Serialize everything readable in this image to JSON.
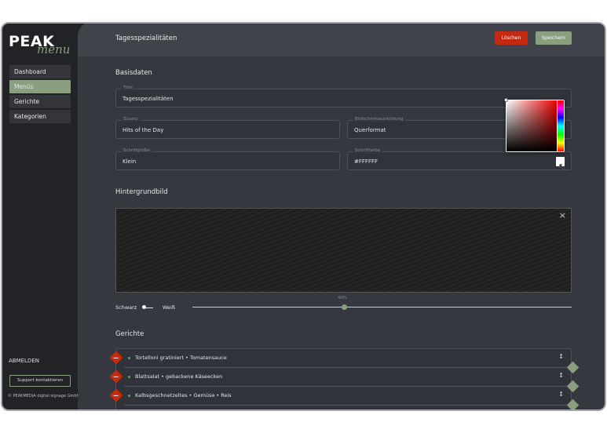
{
  "logo": {
    "brand": "PEAK",
    "sub": "menu"
  },
  "sidebar": {
    "items": [
      {
        "label": "Dashboard"
      },
      {
        "label": "Menüs",
        "active": true
      },
      {
        "label": "Gerichte"
      },
      {
        "label": "Kategorien"
      }
    ],
    "logout": "ABMELDEN",
    "support": "Support kontaktieren",
    "copyright": "© PEAKMEDIA digital signage GmbH"
  },
  "header": {
    "title": "Tagesspezialitäten",
    "delete": "Löschen",
    "save": "Speichern"
  },
  "colors": {
    "accent": "#8a9e80",
    "danger": "#c42a12"
  },
  "basis": {
    "heading": "Basisdaten",
    "fields": {
      "titel": {
        "label": "Titel",
        "value": "Tagesspezialitäten"
      },
      "zusatz": {
        "label": "Zusatz",
        "value": "Hits of the Day"
      },
      "ausrichtung": {
        "label": "Bildschirmausrichtung",
        "value": "Querformat"
      },
      "groesse": {
        "label": "Schriftgröße",
        "value": "Klein"
      },
      "farbe": {
        "label": "Schriftfarbe",
        "value": "#FFFFFF"
      }
    }
  },
  "background": {
    "heading": "Hintergrundbild",
    "toggle_left": "Schwarz",
    "toggle_right": "Weiß",
    "slider_label": "40%",
    "slider_value": 40
  },
  "dishes": {
    "heading": "Gerichte",
    "items": [
      "Tortelloni gratiniert • Tomatensauce",
      "Blattsalat • gebackene Käseecken",
      "Kalbsgeschnetzeltes • Gemüse • Reis"
    ]
  }
}
